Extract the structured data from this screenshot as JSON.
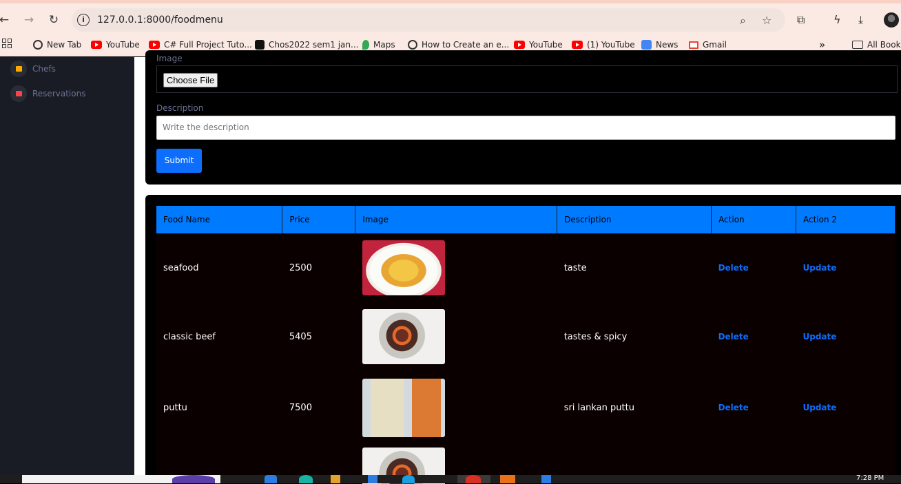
{
  "browser": {
    "url": "127.0.0.1:8000/foodmenu",
    "bookmarks": [
      {
        "label": "New Tab",
        "icon": "globe-icon"
      },
      {
        "label": "YouTube",
        "icon": "youtube-icon"
      },
      {
        "label": "C# Full Project Tuto...",
        "icon": "youtube-icon"
      },
      {
        "label": "Chos2022 sem1 jan...",
        "icon": "site-icon"
      },
      {
        "label": "Maps",
        "icon": "maps-icon"
      },
      {
        "label": "How to Create an e...",
        "icon": "globe-icon"
      },
      {
        "label": "YouTube",
        "icon": "youtube-icon"
      },
      {
        "label": "(1) YouTube",
        "icon": "youtube-icon"
      },
      {
        "label": "News",
        "icon": "news-icon"
      },
      {
        "label": "Gmail",
        "icon": "gmail-icon"
      }
    ],
    "more_bookmarks": "»",
    "all_bookmarks": "All Bookm"
  },
  "sidebar": {
    "items": [
      {
        "label": "Chefs",
        "color": "#ffab00"
      },
      {
        "label": "Reservations",
        "color": "#fc424a"
      }
    ]
  },
  "form": {
    "image_label": "Image",
    "choose_file": "Choose File",
    "description_label": "Description",
    "description_placeholder": "Write the description",
    "submit": "Submit"
  },
  "table": {
    "headers": [
      "Food Name",
      "Price",
      "Image",
      "Description",
      "Action",
      "Action 2"
    ],
    "rows": [
      {
        "name": "seafood",
        "price": "2500",
        "description": "taste",
        "action": "Delete",
        "action2": "Update"
      },
      {
        "name": "classic beef",
        "price": "5405",
        "description": "tastes & spicy",
        "action": "Delete",
        "action2": "Update"
      },
      {
        "name": "puttu",
        "price": "7500",
        "description": "sri lankan puttu",
        "action": "Delete",
        "action2": "Update"
      }
    ]
  },
  "taskbar": {
    "clock": "7:28 PM"
  },
  "colors": {
    "accent": "#0d6efd",
    "header_blue": "#007bff",
    "sidebar_bg": "#191c24"
  }
}
